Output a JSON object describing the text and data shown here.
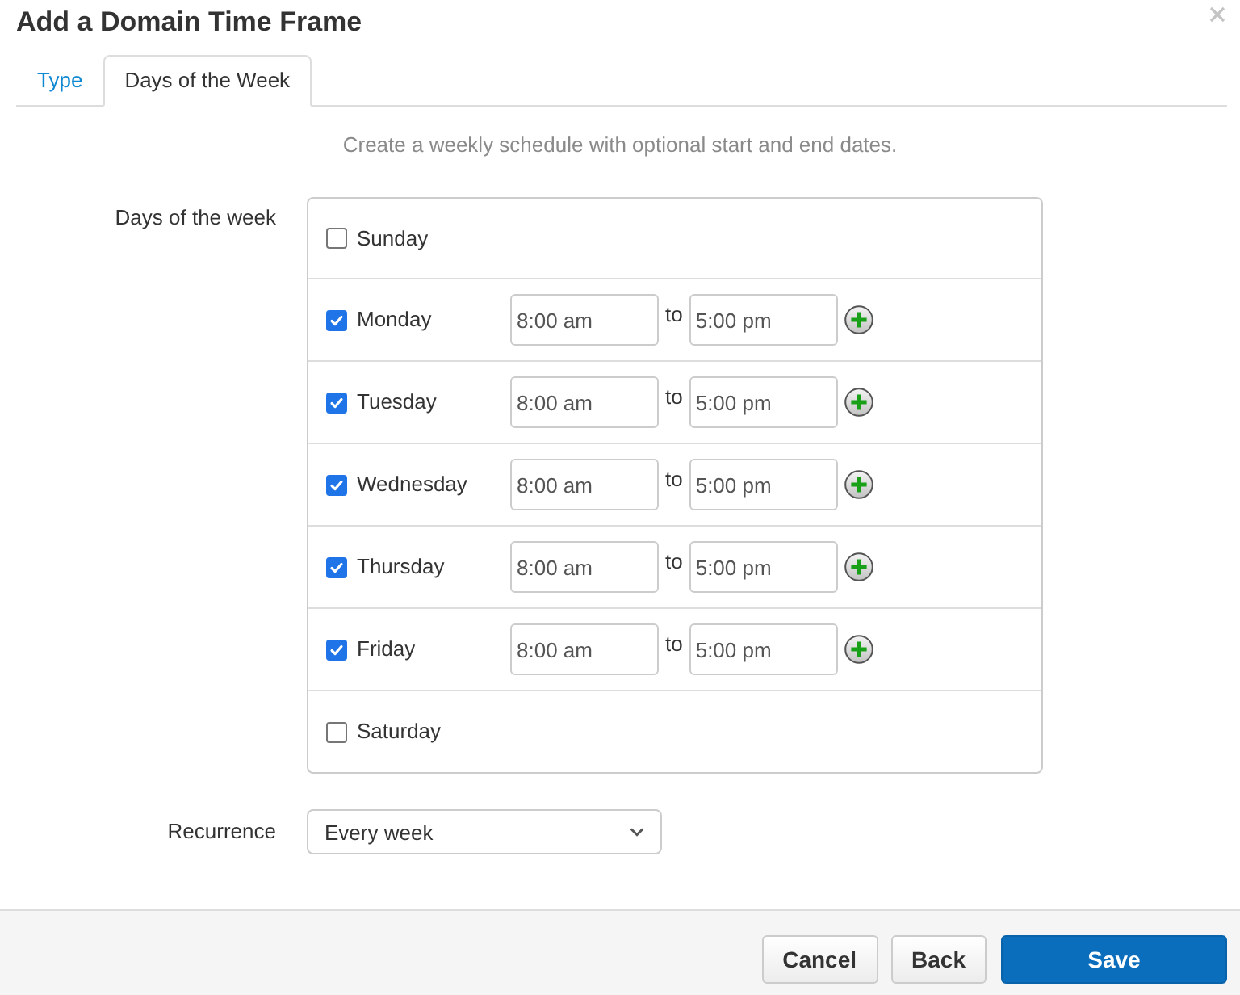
{
  "window": {
    "title": "Add a Domain Time Frame"
  },
  "tabs": [
    {
      "label": "Type",
      "selected": false
    },
    {
      "label": "Days of the Week",
      "selected": true
    }
  ],
  "description": "Create a weekly schedule with optional start and end dates.",
  "days_of_week": {
    "label": "Days of the week",
    "days": [
      {
        "name": "Sunday",
        "checked": false
      },
      {
        "name": "Monday",
        "checked": true,
        "start": "8:00 am",
        "separator": "to",
        "end": "5:00 pm"
      },
      {
        "name": "Tuesday",
        "checked": true,
        "start": "8:00 am",
        "separator": "to",
        "end": "5:00 pm"
      },
      {
        "name": "Wednesday",
        "checked": true,
        "start": "8:00 am",
        "separator": "to",
        "end": "5:00 pm"
      },
      {
        "name": "Thursday",
        "checked": true,
        "start": "8:00 am",
        "separator": "to",
        "end": "5:00 pm"
      },
      {
        "name": "Friday",
        "checked": true,
        "start": "8:00 am",
        "separator": "to",
        "end": "5:00 pm"
      },
      {
        "name": "Saturday",
        "checked": false
      }
    ]
  },
  "recurrence": {
    "label": "Recurrence",
    "value": "Every week"
  },
  "buttons": [
    {
      "label": "Cancel",
      "kind": "secondary"
    },
    {
      "label": "Back",
      "kind": "secondary"
    },
    {
      "label": "Save",
      "kind": "primary"
    }
  ]
}
